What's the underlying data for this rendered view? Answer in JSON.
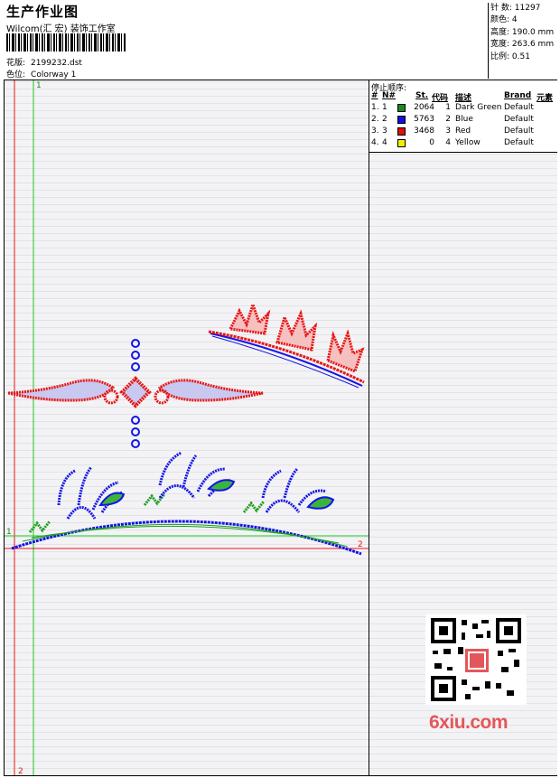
{
  "header": {
    "title": "生产作业图",
    "subtitle": "Wilcom(汇 宏) 装饰工作室",
    "design_label": "花版:",
    "design_value": "2199232.dst",
    "colorway_label": "色位:",
    "colorway_value": "Colorway 1"
  },
  "summary": {
    "stitches_label": "针 数:",
    "stitches_value": "11297",
    "colors_label": "颜色:",
    "colors_value": "4",
    "height_label": "高度:",
    "height_value": "190.0 mm",
    "width_label": "宽度:",
    "width_value": "263.6 mm",
    "ratio_label": "比例:",
    "ratio_value": "0.51"
  },
  "stop_sequence": {
    "title": "停止顺序:",
    "columns": [
      "#",
      "N#",
      "St.",
      "代码",
      "描述",
      "Brand",
      "元素"
    ],
    "rows": [
      {
        "idx": "1.",
        "n": "1",
        "color": "#1a8a1a",
        "st": "2064",
        "code": "1",
        "desc": "Dark Green",
        "brand": "Default"
      },
      {
        "idx": "2.",
        "n": "2",
        "color": "#1010e0",
        "st": "5763",
        "code": "2",
        "desc": "Blue",
        "brand": "Default"
      },
      {
        "idx": "3.",
        "n": "3",
        "color": "#e01010",
        "st": "3468",
        "code": "3",
        "desc": "Red",
        "brand": "Default"
      },
      {
        "idx": "4.",
        "n": "4",
        "color": "#f0f000",
        "st": "0",
        "code": "4",
        "desc": "Yellow",
        "brand": "Default"
      }
    ]
  },
  "guides": {
    "v1_label": "1",
    "v2_label": "2",
    "h1_label": "1",
    "h2_label": "2"
  },
  "colors": {
    "red": "#e81515",
    "blue": "#1414e6",
    "green": "#1e9e1e"
  },
  "watermark": "6xiu.com"
}
